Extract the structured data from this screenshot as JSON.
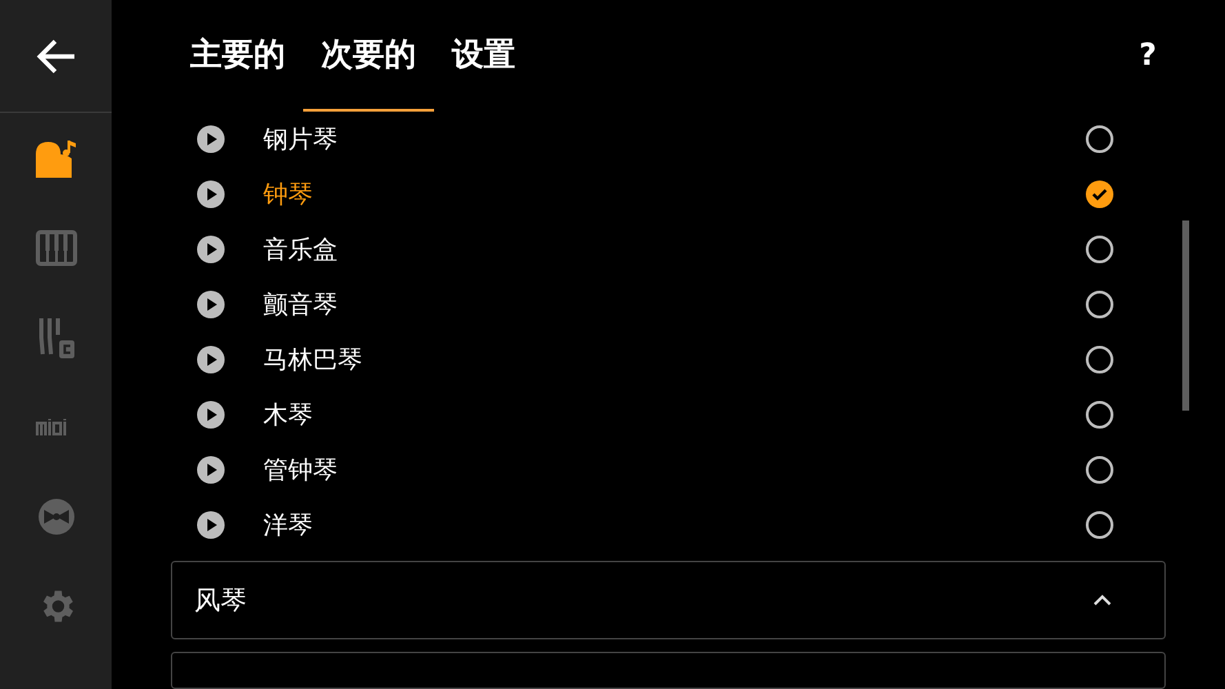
{
  "tabs": [
    {
      "label": "主要的",
      "selected": false
    },
    {
      "label": "次要的",
      "selected": true
    },
    {
      "label": "设置",
      "selected": false
    }
  ],
  "help": "?",
  "sidebar": {
    "items": [
      {
        "kind": "instrument",
        "selected": true
      },
      {
        "kind": "keyboard",
        "selected": false
      },
      {
        "kind": "tuning",
        "selected": false
      },
      {
        "kind": "midi",
        "selected": false
      },
      {
        "kind": "disc",
        "selected": false
      },
      {
        "kind": "settings",
        "selected": false
      }
    ]
  },
  "sounds": [
    {
      "name": "钢片琴",
      "selected": false
    },
    {
      "name": "钟琴",
      "selected": true
    },
    {
      "name": "音乐盒",
      "selected": false
    },
    {
      "name": "颤音琴",
      "selected": false
    },
    {
      "name": "马林巴琴",
      "selected": false
    },
    {
      "name": "木琴",
      "selected": false
    },
    {
      "name": "管钟琴",
      "selected": false
    },
    {
      "name": "洋琴",
      "selected": false
    }
  ],
  "groups": [
    {
      "title": "风琴",
      "expanded": true
    }
  ]
}
